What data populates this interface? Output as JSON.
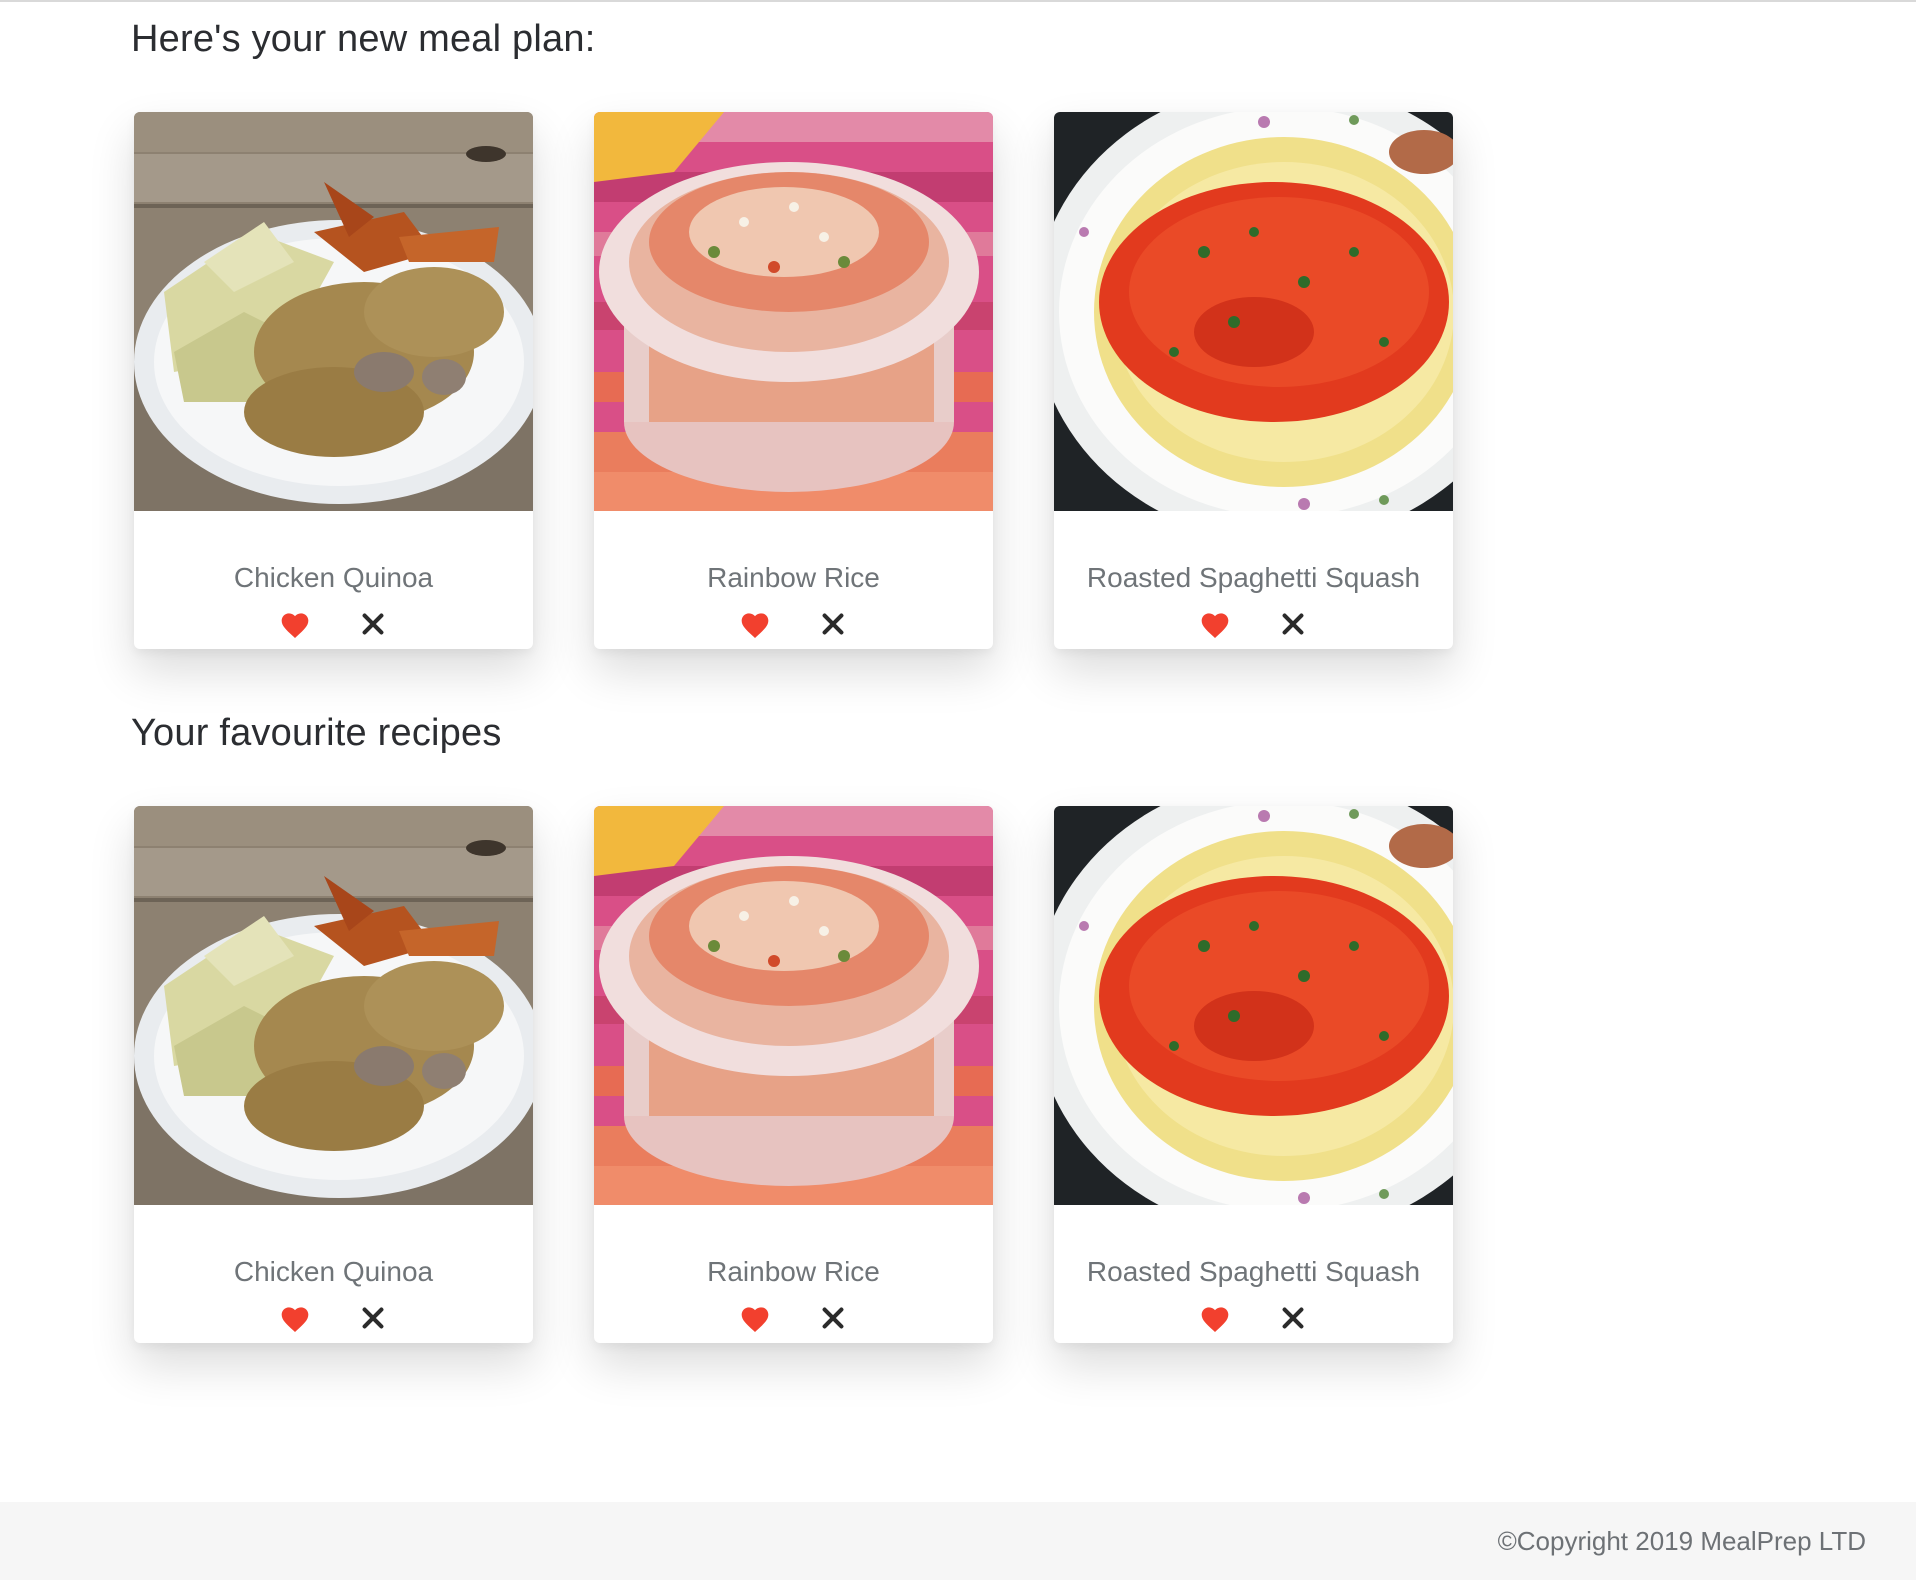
{
  "meal_plan": {
    "title": "Here's your new meal plan:",
    "recipes": [
      {
        "name": "Chicken Quinoa",
        "image_icon": "chicken-quinoa-photo",
        "like_icon": "heart-icon",
        "remove_icon": "close-icon"
      },
      {
        "name": "Rainbow Rice",
        "image_icon": "rainbow-rice-photo",
        "like_icon": "heart-icon",
        "remove_icon": "close-icon"
      },
      {
        "name": "Roasted Spaghetti Squash",
        "image_icon": "spaghetti-squash-photo",
        "like_icon": "heart-icon",
        "remove_icon": "close-icon"
      }
    ]
  },
  "favourites": {
    "title": "Your favourite recipes",
    "recipes": [
      {
        "name": "Chicken Quinoa",
        "image_icon": "chicken-quinoa-photo",
        "like_icon": "heart-icon",
        "remove_icon": "close-icon"
      },
      {
        "name": "Rainbow Rice",
        "image_icon": "rainbow-rice-photo",
        "like_icon": "heart-icon",
        "remove_icon": "close-icon"
      },
      {
        "name": "Roasted Spaghetti Squash",
        "image_icon": "spaghetti-squash-photo",
        "like_icon": "heart-icon",
        "remove_icon": "close-icon"
      }
    ]
  },
  "footer": {
    "copyright": "©Copyright 2019 MealPrep LTD"
  },
  "colors": {
    "heart": "#f2402e",
    "close": "#2b2b2b",
    "heading": "#2b2d31",
    "card_title": "#6f7478",
    "footer_bg": "#f6f6f6"
  }
}
